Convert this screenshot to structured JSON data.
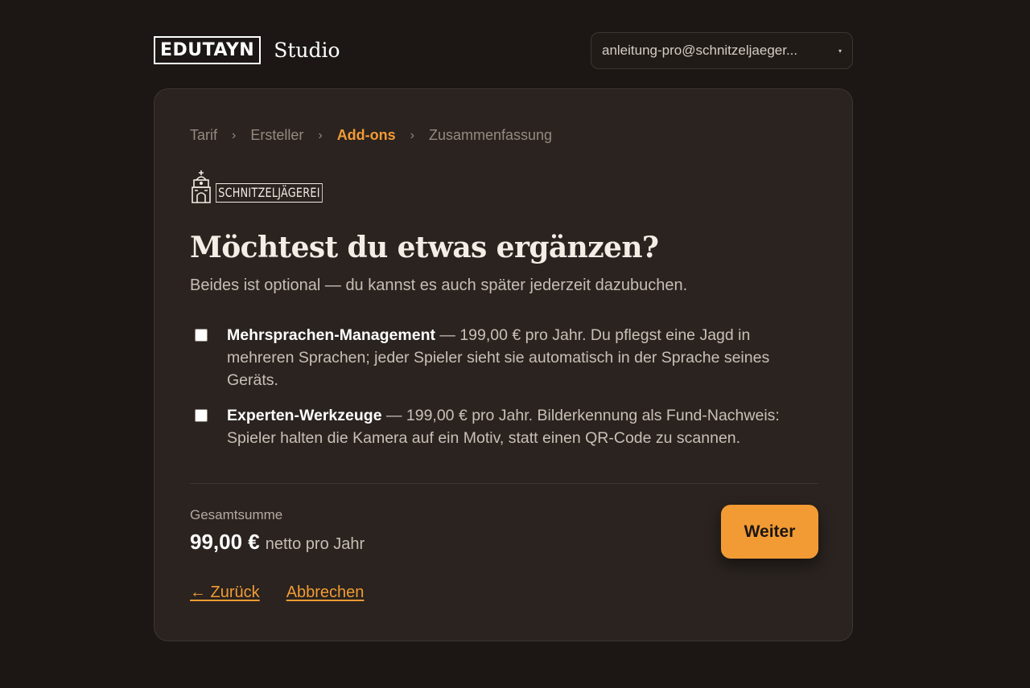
{
  "header": {
    "brand": "EDUTAYN",
    "product": "Studio",
    "account_email": "anleitung-pro@schnitzeljaeger...",
    "caret": "▾"
  },
  "breadcrumb": {
    "steps": [
      "Tarif",
      "Ersteller",
      "Add-ons",
      "Zusammenfassung"
    ],
    "active_index": 2,
    "separator": "›"
  },
  "logo": {
    "text": "SCHNITZELJÄGEREI",
    "icon": "castle-icon"
  },
  "main": {
    "title": "Möchtest du etwas ergänzen?",
    "subtitle": "Beides ist optional — du kannst es auch später jederzeit dazubuchen."
  },
  "options": [
    {
      "name": "Mehrsprachen-Management",
      "description": " — 199,00 € pro Jahr. Du pflegst eine Jagd in mehreren Sprachen; jeder Spieler sieht sie automatisch in der Sprache seines Geräts.",
      "checked": false
    },
    {
      "name": "Experten-Werkzeuge",
      "description": " — 199,00 € pro Jahr. Bilderkennung als Fund-Nachweis: Spieler halten die Kamera auf ein Motiv, statt einen QR-Code zu scannen.",
      "checked": false
    }
  ],
  "total": {
    "label": "Gesamtsumme",
    "amount": "99,00 €",
    "suffix": "netto pro Jahr"
  },
  "actions": {
    "next": "Weiter",
    "back": "← Zurück",
    "cancel": "Abbrechen"
  },
  "colors": {
    "background": "#1c1714",
    "card": "#2a231f",
    "accent": "#f29b34"
  }
}
